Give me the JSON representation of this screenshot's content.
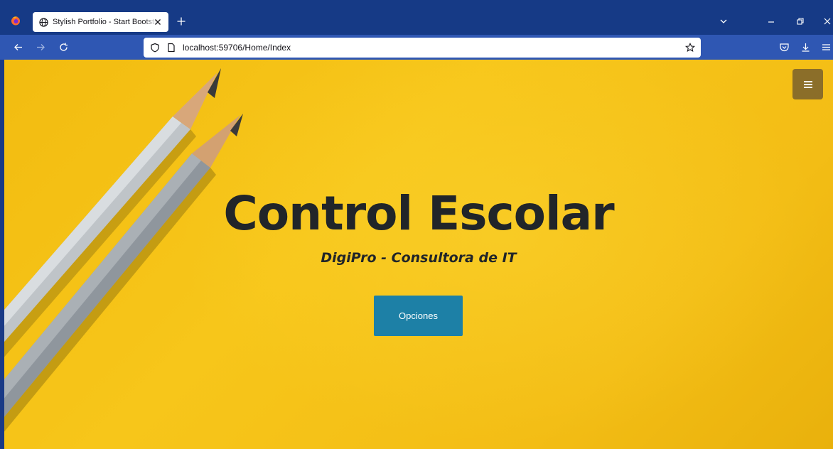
{
  "browser": {
    "tab": {
      "title": "Stylish Portfolio - Start Bootstrap Theme"
    },
    "address": {
      "url": "localhost:59706/Home/Index"
    }
  },
  "page": {
    "hero": {
      "title": "Control Escolar",
      "subtitle": "DigiPro - Consultora de IT",
      "button_label": "Opciones"
    }
  },
  "colors": {
    "titlebar": "#163a86",
    "navbar": "#2f57b3",
    "hero_background": "#f7c61a",
    "button": "#1d80a6",
    "text": "#212529"
  },
  "icons": {
    "menu_toggle": "hamburger-icon",
    "tab": "globe-icon",
    "address": [
      "shield-icon",
      "page-icon",
      "star-icon"
    ],
    "toolbar": [
      "pocket-icon",
      "download-icon",
      "app-menu-icon"
    ]
  }
}
